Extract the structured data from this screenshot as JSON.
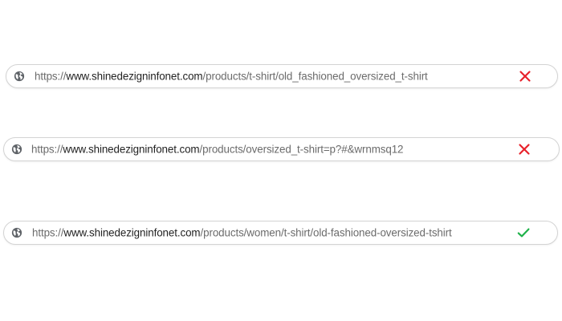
{
  "urls": [
    {
      "scheme": "https://",
      "domain": "www.shinedezigninfonet.com",
      "path": "/products/t-shirt/old_fashioned_oversized_t-shirt",
      "status": "invalid",
      "status_icon": "cross-icon"
    },
    {
      "scheme": "https://",
      "domain": "www.shinedezigninfonet.com",
      "path": "/products/oversized_t-shirt=p?#&wrnmsq12",
      "status": "invalid",
      "status_icon": "cross-icon"
    },
    {
      "scheme": "https://",
      "domain": "www.shinedezigninfonet.com",
      "path": "/products/women/t-shirt/old-fashioned-oversized-tshirt",
      "status": "valid",
      "status_icon": "checkmark-icon"
    }
  ],
  "colors": {
    "invalid": "#e8222b",
    "valid": "#1fb24a",
    "scheme": "#6b6b6b",
    "domain": "#222222",
    "path": "#6b6b6b",
    "border": "#d3d3d3"
  }
}
